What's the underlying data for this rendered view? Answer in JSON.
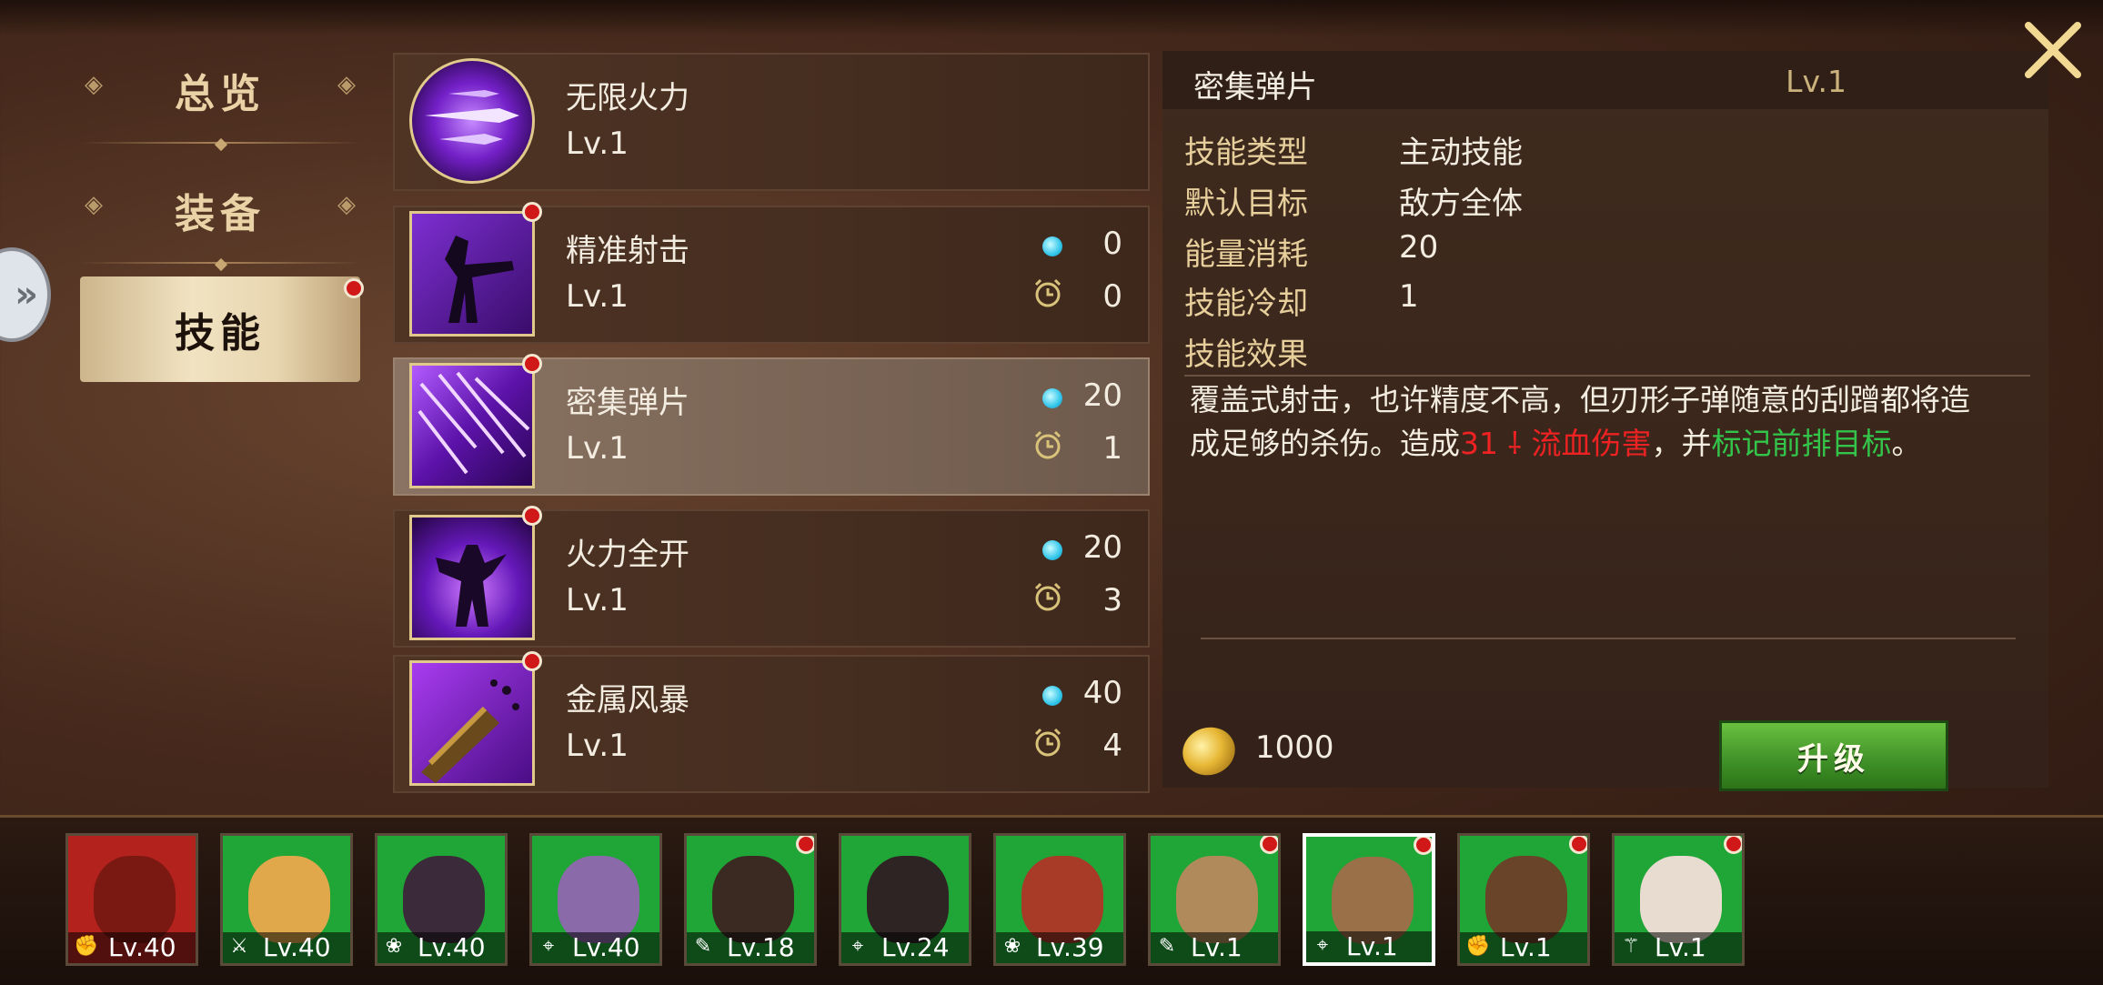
{
  "tabs": [
    {
      "label": "总览"
    },
    {
      "label": "装备"
    },
    {
      "label": "技能"
    }
  ],
  "skills": [
    {
      "name": "无限火力",
      "level": "Lv.1"
    },
    {
      "name": "精准射击",
      "level": "Lv.1",
      "energy": "0",
      "cooldown": "0"
    },
    {
      "name": "密集弹片",
      "level": "Lv.1",
      "energy": "20",
      "cooldown": "1"
    },
    {
      "name": "火力全开",
      "level": "Lv.1",
      "energy": "20",
      "cooldown": "3"
    },
    {
      "name": "金属风暴",
      "level": "Lv.1",
      "energy": "40",
      "cooldown": "4"
    }
  ],
  "detail": {
    "title": "密集弹片",
    "level": "Lv.1",
    "rows": [
      {
        "label": "技能类型",
        "value": "主动技能"
      },
      {
        "label": "默认目标",
        "value": "敌方全体"
      },
      {
        "label": "能量消耗",
        "value": "20"
      },
      {
        "label": "技能冷却",
        "value": "1"
      },
      {
        "label": "技能效果",
        "value": ""
      }
    ],
    "desc_a": "覆盖式射击，也许精度不高，但刃形子弹随意的刮蹭都将造成足够的杀伤。造成",
    "desc_num": "31",
    "desc_red": "流血伤害",
    "desc_b": "，并",
    "desc_green": "标记前排目标",
    "desc_c": "。",
    "cost": "1000",
    "upgrade_label": "升级"
  },
  "heroes": [
    {
      "level": "Lv.40",
      "role": "fist-icon"
    },
    {
      "level": "Lv.40",
      "role": "sword-icon"
    },
    {
      "level": "Lv.40",
      "role": "lotus-icon"
    },
    {
      "level": "Lv.40",
      "role": "crosshair-icon"
    },
    {
      "level": "Lv.18",
      "role": "wand-icon"
    },
    {
      "level": "Lv.24",
      "role": "crosshair-icon"
    },
    {
      "level": "Lv.39",
      "role": "lotus-icon"
    },
    {
      "level": "Lv.1",
      "role": "wand-icon"
    },
    {
      "level": "Lv.1",
      "role": "crosshair-icon"
    },
    {
      "level": "Lv.1",
      "role": "fist-icon"
    },
    {
      "level": "Lv.1",
      "role": "staff-icon"
    }
  ],
  "colors": {
    "accent_red": "#ee2222",
    "accent_green": "#33c44a",
    "energy": "#32c6ea"
  }
}
